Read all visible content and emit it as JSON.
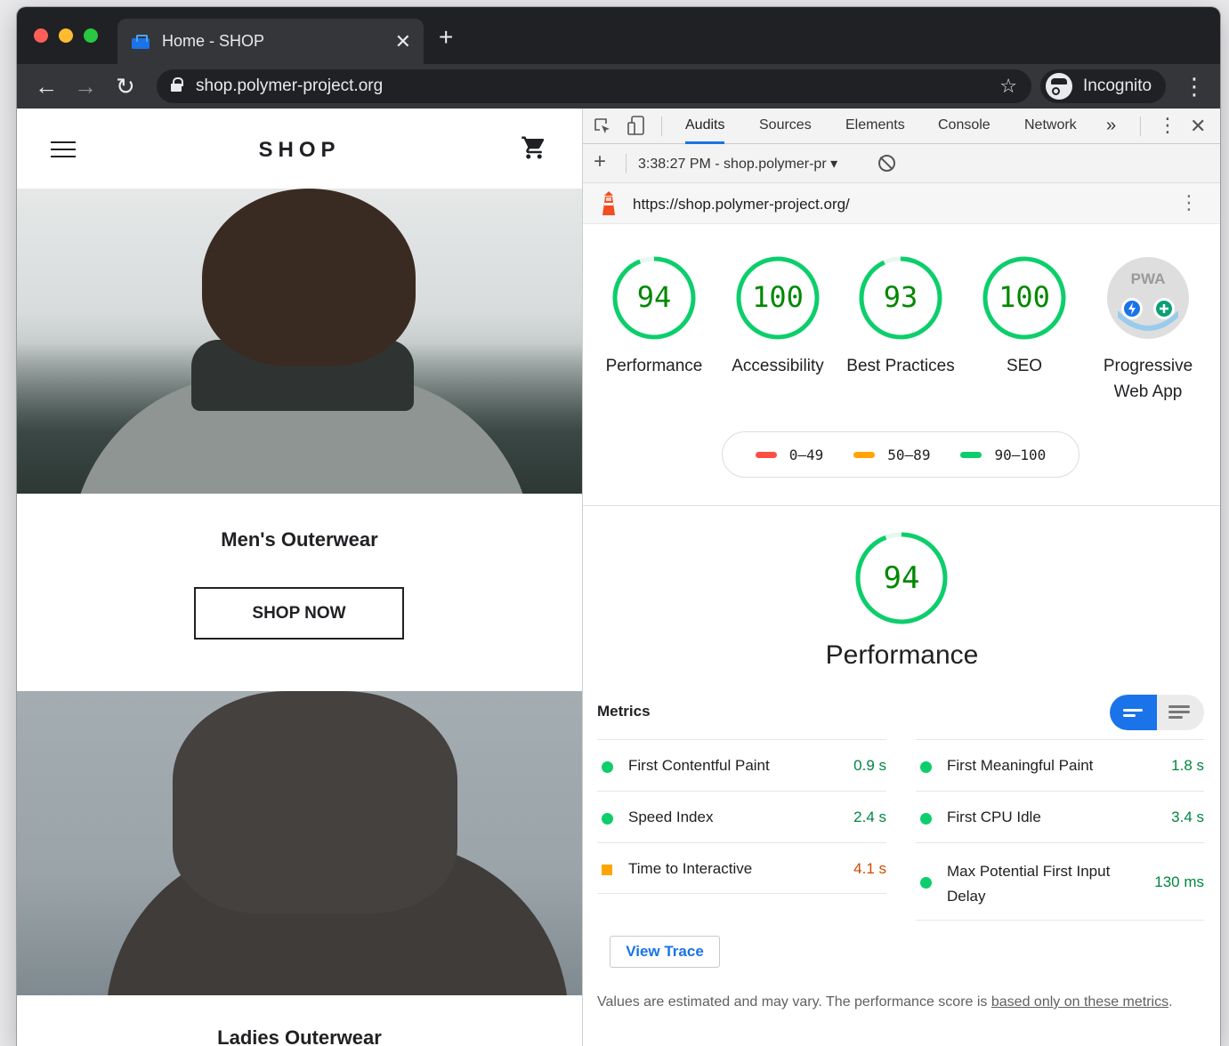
{
  "browser": {
    "tab_title": "Home - SHOP",
    "url": "shop.polymer-project.org",
    "incognito_label": "Incognito",
    "close_glyph": "✕",
    "new_tab_glyph": "+",
    "back_glyph": "←",
    "forward_glyph": "→",
    "reload_glyph": "↻",
    "star_glyph": "☆",
    "menu_glyph": "⋮"
  },
  "shop": {
    "title": "SHOP",
    "categories": [
      {
        "title": "Men's Outerwear",
        "button": "SHOP NOW"
      },
      {
        "title": "Ladies Outerwear"
      }
    ]
  },
  "devtools": {
    "tabs": [
      "Audits",
      "Sources",
      "Elements",
      "Console",
      "Network"
    ],
    "active_tab": "Audits",
    "more_glyph": "»",
    "kebab_glyph": "⋮",
    "close_glyph": "✕",
    "plus_glyph": "+",
    "report_label": "3:38:27 PM - shop.polymer-pr ▾",
    "report_url": "https://shop.polymer-project.org/",
    "url_kebab_glyph": "⋮"
  },
  "audits": {
    "scores": [
      {
        "value": "94",
        "label": "Performance"
      },
      {
        "value": "100",
        "label": "Accessibility"
      },
      {
        "value": "93",
        "label": "Best Practices"
      },
      {
        "value": "100",
        "label": "SEO"
      }
    ],
    "score_fractions": [
      0.94,
      1.0,
      0.93,
      1.0
    ],
    "pwa": {
      "badge": "PWA",
      "label": "Progressive Web App"
    },
    "legend": [
      {
        "range": "0–49",
        "color": "#ff4e42"
      },
      {
        "range": "50–89",
        "color": "#ffa400"
      },
      {
        "range": "90–100",
        "color": "#0cce6b"
      }
    ],
    "performance": {
      "score": "94",
      "score_fraction": 0.94,
      "title": "Performance",
      "metrics_heading": "Metrics",
      "metrics_left": [
        {
          "name": "First Contentful Paint",
          "value": "0.9 s",
          "status": "pass"
        },
        {
          "name": "Speed Index",
          "value": "2.4 s",
          "status": "pass"
        },
        {
          "name": "Time to Interactive",
          "value": "4.1 s",
          "status": "average"
        }
      ],
      "metrics_right": [
        {
          "name": "First Meaningful Paint",
          "value": "1.8 s",
          "status": "pass"
        },
        {
          "name": "First CPU Idle",
          "value": "3.4 s",
          "status": "pass"
        },
        {
          "name": "Max Potential First Input Delay",
          "value": "130 ms",
          "status": "pass"
        }
      ],
      "view_trace": "View Trace",
      "disclaimer_text": "Values are estimated and may vary. The performance score is ",
      "disclaimer_link": "based only on these metrics",
      "disclaimer_end": "."
    },
    "colors": {
      "pass": "#0cce6b",
      "average": "#ffa400",
      "fail": "#ff4e42",
      "accent": "#1a73e8"
    }
  }
}
